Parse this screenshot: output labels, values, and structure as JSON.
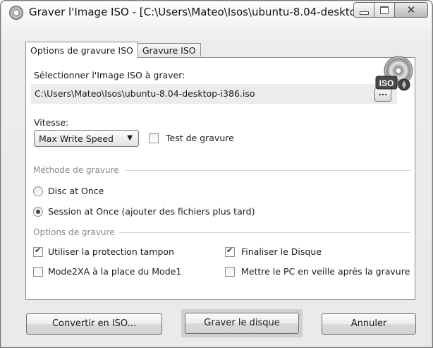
{
  "window": {
    "title": "Graver l'Image ISO - [C:\\Users\\Mateo\\Isos\\ubuntu-8.04-desktop...",
    "controls": {
      "minimize": "minimize-icon",
      "maximize": "maximize-icon",
      "close": "✕"
    }
  },
  "tabs": [
    {
      "label": "Options de gravure ISO",
      "active": true
    },
    {
      "label": "Gravure ISO",
      "active": false
    }
  ],
  "iso": {
    "label": "Sélectionner l'Image ISO à graver:",
    "path": "C:\\Users\\Mateo\\Isos\\ubuntu-8.04-desktop-i386.iso",
    "browse_label": "...",
    "icon": "iso-disc-icon",
    "icon_text": "ISO"
  },
  "speed": {
    "label": "Vitesse:",
    "selected": "Max Write Speed",
    "test_label": "Test de gravure",
    "test_checked": false
  },
  "method": {
    "title": "Méthode de gravure",
    "options": [
      {
        "label": "Disc at Once",
        "selected": false
      },
      {
        "label": "Session at Once (ajouter des fichiers plus tard)",
        "selected": true
      }
    ]
  },
  "options": {
    "title": "Options de gravure",
    "items": [
      {
        "label": "Utiliser la protection tampon",
        "checked": true
      },
      {
        "label": "Finaliser le Disque",
        "checked": true
      },
      {
        "label": "Mode2XA à la place du Mode1",
        "checked": false
      },
      {
        "label": "Mettre le PC en veille après la gravure",
        "checked": false
      }
    ]
  },
  "buttons": {
    "convert": "Convertir en ISO...",
    "burn": "Graver le disque",
    "cancel": "Annuler"
  }
}
